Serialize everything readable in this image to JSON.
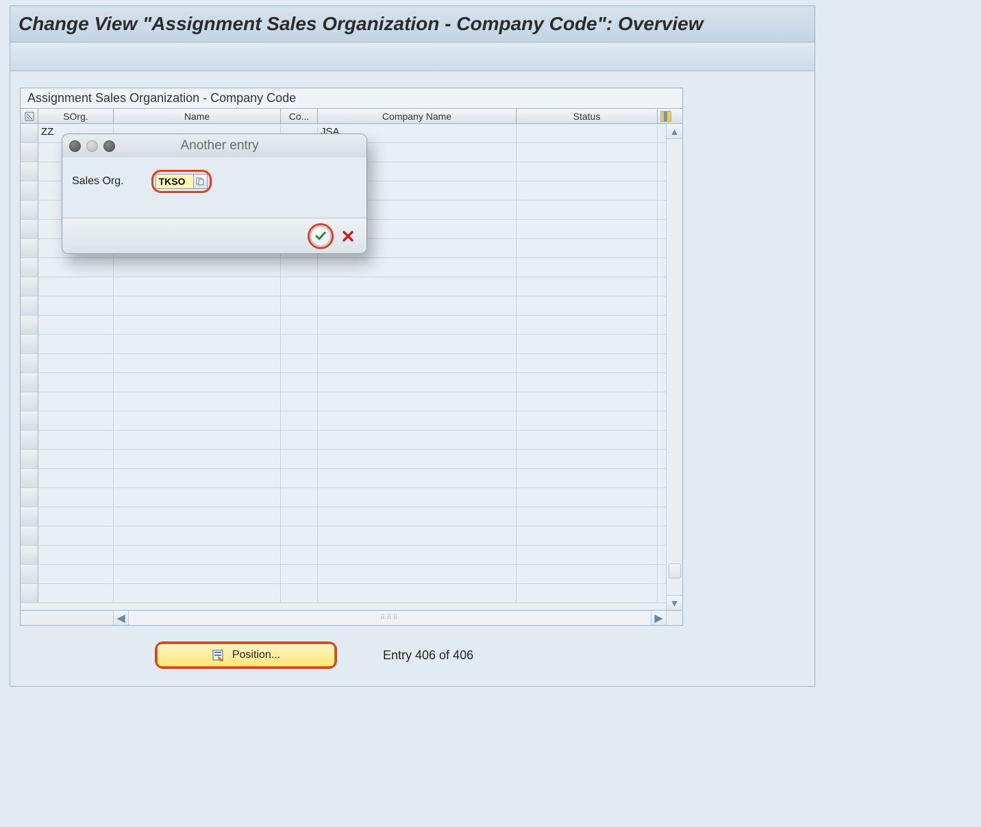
{
  "header": {
    "title": "Change View \"Assignment Sales Organization - Company Code\": Overview"
  },
  "panel": {
    "title": "Assignment Sales Organization - Company Code",
    "columns": {
      "sorg": "SOrg.",
      "name": "Name",
      "cocd": "Co...",
      "company_name": "Company Name",
      "status": "Status"
    },
    "rows": [
      {
        "sorg": "ZZ",
        "name": "",
        "cocd": "",
        "company_name": "JSA",
        "status": ""
      }
    ],
    "empty_row_count": 24
  },
  "footer": {
    "position_label": "Position...",
    "entry_text": "Entry 406 of 406"
  },
  "dialog": {
    "title": "Another entry",
    "field_label": "Sales Org.",
    "field_value": "TKSO"
  }
}
